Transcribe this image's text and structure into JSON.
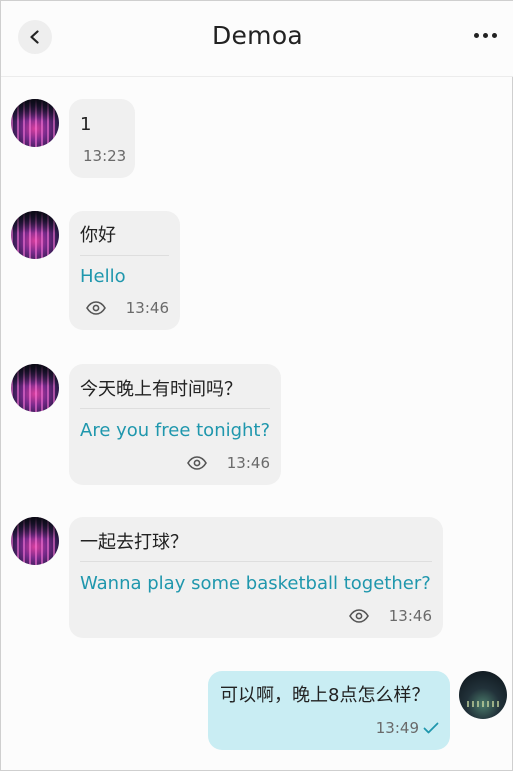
{
  "header": {
    "title": "Demoa"
  },
  "messages": [
    {
      "text": "1",
      "time": "13:23"
    },
    {
      "text": "你好",
      "translation": "Hello",
      "time": "13:46"
    },
    {
      "text": "今天晚上有时间吗？",
      "translation": "Are you free tonight?",
      "time": "13:46"
    },
    {
      "text": "一起去打球？",
      "translation": "Wanna play some basketball together?",
      "time": "13:46"
    },
    {
      "text": "可以啊，晚上8点怎么样？",
      "time": "13:49"
    }
  ],
  "icons": {
    "back": "chevron-left-icon",
    "more": "more-horizontal-icon",
    "seen": "eye-icon",
    "delivered": "check-icon"
  },
  "colors": {
    "incoming_bubble": "#f0f0f0",
    "outgoing_bubble": "#c9edf3",
    "translation_text": "#1f97ad",
    "check": "#1f97ad"
  }
}
